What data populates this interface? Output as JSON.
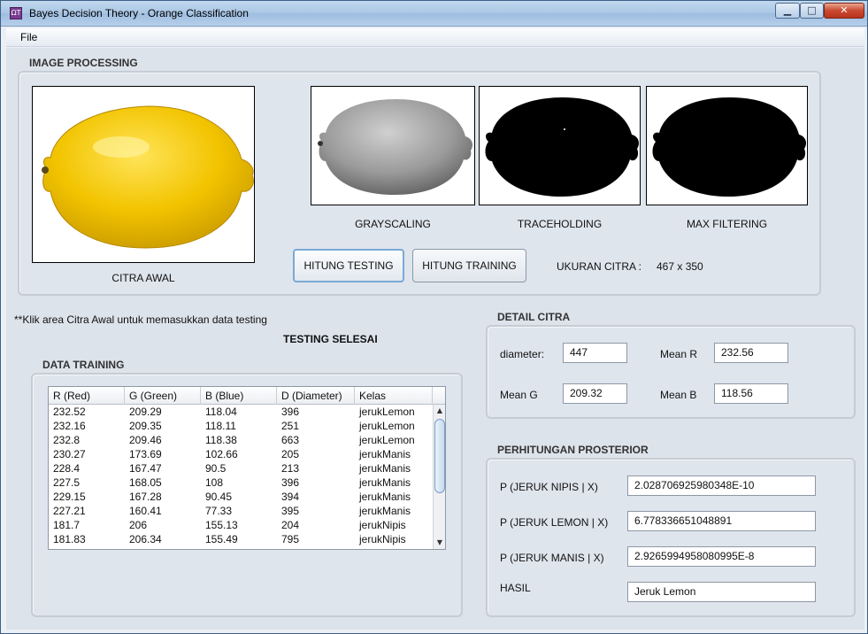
{
  "window": {
    "title": "Bayes Decision Theory - Orange Classification",
    "min_glyph": "▁",
    "max_glyph": "□",
    "close_glyph": "✕",
    "app_icon_text": "ΩT"
  },
  "menu": {
    "file": "File"
  },
  "image_processing": {
    "title": "IMAGE PROCESSING",
    "captions": {
      "original": "CITRA AWAL",
      "grayscale": "GRAYSCALING",
      "threshold": "TRACEHOLDING",
      "maxfilter": "MAX FILTERING"
    },
    "btn_testing": "HITUNG TESTING",
    "btn_training": "HITUNG TRAINING",
    "size_label": "UKURAN CITRA :",
    "size_value": "467 x 350"
  },
  "hint": "**Klik area Citra Awal untuk memasukkan data testing",
  "status": "TESTING SELESAI",
  "training": {
    "title": "DATA TRAINING",
    "columns": [
      "R (Red)",
      "G (Green)",
      "B (Blue)",
      "D (Diameter)",
      "Kelas"
    ],
    "rows": [
      [
        "232.52",
        "209.29",
        "118.04",
        "396",
        "jerukLemon"
      ],
      [
        "232.16",
        "209.35",
        "118.11",
        "251",
        "jerukLemon"
      ],
      [
        "232.8",
        "209.46",
        "118.38",
        "663",
        "jerukLemon"
      ],
      [
        "230.27",
        "173.69",
        "102.66",
        "205",
        "jerukManis"
      ],
      [
        "228.4",
        "167.47",
        "90.5",
        "213",
        "jerukManis"
      ],
      [
        "227.5",
        "168.05",
        "108",
        "396",
        "jerukManis"
      ],
      [
        "229.15",
        "167.28",
        "90.45",
        "394",
        "jerukManis"
      ],
      [
        "227.21",
        "160.41",
        "77.33",
        "395",
        "jerukManis"
      ],
      [
        "181.7",
        "206",
        "155.13",
        "204",
        "jerukNipis"
      ],
      [
        "181.83",
        "206.34",
        "155.49",
        "795",
        "jerukNipis"
      ]
    ],
    "scroll_up": "▲",
    "scroll_down": "▼"
  },
  "detail": {
    "title": "DETAIL CITRA",
    "diameter_label": "diameter:",
    "diameter_value": "447",
    "mean_r_label": "Mean R",
    "mean_r_value": "232.56",
    "mean_g_label": "Mean G",
    "mean_g_value": "209.32",
    "mean_b_label": "Mean B",
    "mean_b_value": "118.56"
  },
  "posterior": {
    "title": "PERHITUNGAN PROSTERIOR",
    "nipis_label": "P (JERUK NIPIS | X)",
    "nipis_value": "2.028706925980348E-10",
    "lemon_label": "P (JERUK LEMON | X)",
    "lemon_value": "6.778336651048891",
    "manis_label": "P (JERUK MANIS | X)",
    "manis_value": "2.9265994958080995E-8",
    "result_label": "HASIL",
    "result_value": "Jeruk Lemon"
  },
  "colors": {
    "lemon": "#f2c400",
    "lemon_shadow": "#c99a00",
    "gray": "#9a9a9a",
    "mask": "#000000"
  }
}
